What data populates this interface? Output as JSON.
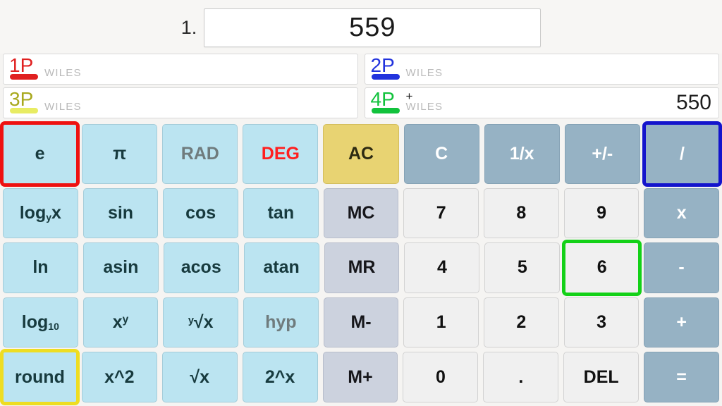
{
  "display": {
    "index_label": "1.",
    "value": "559"
  },
  "players": [
    {
      "id": "1P",
      "name": "WILES",
      "color": "#e02020",
      "plus": "",
      "score": ""
    },
    {
      "id": "2P",
      "name": "WILES",
      "color": "#2233dd",
      "plus": "",
      "score": ""
    },
    {
      "id": "3P",
      "name": "WILES",
      "color": "#e8ec63",
      "plus": "",
      "score": ""
    },
    {
      "id": "4P",
      "name": "WILES",
      "color": "#11c23c",
      "plus": "+",
      "score": "550"
    }
  ],
  "player_id_text_colors": {
    "1P": "#e02020",
    "2P": "#2233dd",
    "3P": "#a8a81d",
    "4P": "#11c23c"
  },
  "highlights": {
    "e": "#ee1111",
    "divide": "#1414cc",
    "six": "#13d117",
    "round": "#eedd22"
  },
  "colors": {
    "function_key": "#bbe4f1",
    "operator_key": "#96b2c4",
    "memory_key": "#ccd2de",
    "number_key": "#f0f0f0",
    "all_clear_key": "#e8d372",
    "deg_text": "#ff1f1f",
    "page_background": "#f5f4f2"
  },
  "keypad": {
    "rows": [
      [
        {
          "label": "e",
          "kind": "fn",
          "html": "e"
        },
        {
          "label": "π",
          "kind": "fn",
          "html": "π"
        },
        {
          "label": "RAD",
          "kind": "fn-muted",
          "html": "RAD"
        },
        {
          "label": "DEG",
          "kind": "fn-deg",
          "html": "DEG"
        },
        {
          "label": "AC",
          "kind": "ac",
          "html": "AC"
        },
        {
          "label": "C",
          "kind": "op",
          "html": "C"
        },
        {
          "label": "1/x",
          "kind": "op",
          "html": "1/x"
        },
        {
          "label": "+/-",
          "kind": "op",
          "html": "+/-"
        },
        {
          "label": "/",
          "kind": "op",
          "html": "/"
        }
      ],
      [
        {
          "label": "log_y x",
          "kind": "fn",
          "html": "log<sub>y</sub>x"
        },
        {
          "label": "sin",
          "kind": "fn",
          "html": "sin"
        },
        {
          "label": "cos",
          "kind": "fn",
          "html": "cos"
        },
        {
          "label": "tan",
          "kind": "fn",
          "html": "tan"
        },
        {
          "label": "MC",
          "kind": "mem",
          "html": "MC"
        },
        {
          "label": "7",
          "kind": "num",
          "html": "7"
        },
        {
          "label": "8",
          "kind": "num",
          "html": "8"
        },
        {
          "label": "9",
          "kind": "num",
          "html": "9"
        },
        {
          "label": "x",
          "kind": "op",
          "html": "x"
        }
      ],
      [
        {
          "label": "ln",
          "kind": "fn",
          "html": "ln"
        },
        {
          "label": "asin",
          "kind": "fn",
          "html": "asin"
        },
        {
          "label": "acos",
          "kind": "fn",
          "html": "acos"
        },
        {
          "label": "atan",
          "kind": "fn",
          "html": "atan"
        },
        {
          "label": "MR",
          "kind": "mem",
          "html": "MR"
        },
        {
          "label": "4",
          "kind": "num",
          "html": "4"
        },
        {
          "label": "5",
          "kind": "num",
          "html": "5"
        },
        {
          "label": "6",
          "kind": "num",
          "html": "6"
        },
        {
          "label": "-",
          "kind": "op",
          "html": "-"
        }
      ],
      [
        {
          "label": "log_10",
          "kind": "fn",
          "html": "log<sub>10</sub>"
        },
        {
          "label": "x^y",
          "kind": "fn",
          "html": "x<sup>y</sup>"
        },
        {
          "label": "y root x",
          "kind": "fn",
          "html": "<span class=\"presup\">y</span>√x"
        },
        {
          "label": "hyp",
          "kind": "fn-muted",
          "html": "hyp"
        },
        {
          "label": "M-",
          "kind": "mem",
          "html": "M-"
        },
        {
          "label": "1",
          "kind": "num",
          "html": "1"
        },
        {
          "label": "2",
          "kind": "num",
          "html": "2"
        },
        {
          "label": "3",
          "kind": "num",
          "html": "3"
        },
        {
          "label": "+",
          "kind": "op",
          "html": "+"
        }
      ],
      [
        {
          "label": "round",
          "kind": "fn",
          "html": "round"
        },
        {
          "label": "x^2",
          "kind": "fn",
          "html": "x^2"
        },
        {
          "label": "sqrt x",
          "kind": "fn",
          "html": "√x"
        },
        {
          "label": "2^x",
          "kind": "fn",
          "html": "2^x"
        },
        {
          "label": "M+",
          "kind": "mem",
          "html": "M+"
        },
        {
          "label": "0",
          "kind": "num",
          "html": "0"
        },
        {
          "label": ".",
          "kind": "num",
          "html": "."
        },
        {
          "label": "DEL",
          "kind": "num",
          "html": "DEL"
        },
        {
          "label": "=",
          "kind": "op",
          "html": "="
        }
      ]
    ]
  }
}
